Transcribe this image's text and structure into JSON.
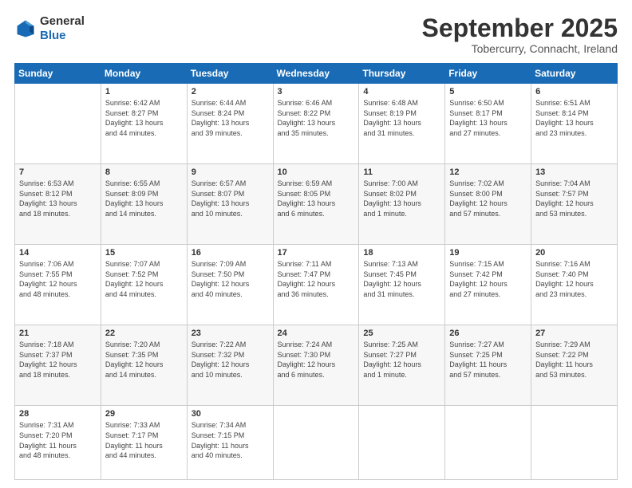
{
  "header": {
    "logo_general": "General",
    "logo_blue": "Blue",
    "month_title": "September 2025",
    "location": "Tobercurry, Connacht, Ireland"
  },
  "days_of_week": [
    "Sunday",
    "Monday",
    "Tuesday",
    "Wednesday",
    "Thursday",
    "Friday",
    "Saturday"
  ],
  "weeks": [
    [
      {
        "day": "",
        "info": ""
      },
      {
        "day": "1",
        "info": "Sunrise: 6:42 AM\nSunset: 8:27 PM\nDaylight: 13 hours\nand 44 minutes."
      },
      {
        "day": "2",
        "info": "Sunrise: 6:44 AM\nSunset: 8:24 PM\nDaylight: 13 hours\nand 39 minutes."
      },
      {
        "day": "3",
        "info": "Sunrise: 6:46 AM\nSunset: 8:22 PM\nDaylight: 13 hours\nand 35 minutes."
      },
      {
        "day": "4",
        "info": "Sunrise: 6:48 AM\nSunset: 8:19 PM\nDaylight: 13 hours\nand 31 minutes."
      },
      {
        "day": "5",
        "info": "Sunrise: 6:50 AM\nSunset: 8:17 PM\nDaylight: 13 hours\nand 27 minutes."
      },
      {
        "day": "6",
        "info": "Sunrise: 6:51 AM\nSunset: 8:14 PM\nDaylight: 13 hours\nand 23 minutes."
      }
    ],
    [
      {
        "day": "7",
        "info": "Sunrise: 6:53 AM\nSunset: 8:12 PM\nDaylight: 13 hours\nand 18 minutes."
      },
      {
        "day": "8",
        "info": "Sunrise: 6:55 AM\nSunset: 8:09 PM\nDaylight: 13 hours\nand 14 minutes."
      },
      {
        "day": "9",
        "info": "Sunrise: 6:57 AM\nSunset: 8:07 PM\nDaylight: 13 hours\nand 10 minutes."
      },
      {
        "day": "10",
        "info": "Sunrise: 6:59 AM\nSunset: 8:05 PM\nDaylight: 13 hours\nand 6 minutes."
      },
      {
        "day": "11",
        "info": "Sunrise: 7:00 AM\nSunset: 8:02 PM\nDaylight: 13 hours\nand 1 minute."
      },
      {
        "day": "12",
        "info": "Sunrise: 7:02 AM\nSunset: 8:00 PM\nDaylight: 12 hours\nand 57 minutes."
      },
      {
        "day": "13",
        "info": "Sunrise: 7:04 AM\nSunset: 7:57 PM\nDaylight: 12 hours\nand 53 minutes."
      }
    ],
    [
      {
        "day": "14",
        "info": "Sunrise: 7:06 AM\nSunset: 7:55 PM\nDaylight: 12 hours\nand 48 minutes."
      },
      {
        "day": "15",
        "info": "Sunrise: 7:07 AM\nSunset: 7:52 PM\nDaylight: 12 hours\nand 44 minutes."
      },
      {
        "day": "16",
        "info": "Sunrise: 7:09 AM\nSunset: 7:50 PM\nDaylight: 12 hours\nand 40 minutes."
      },
      {
        "day": "17",
        "info": "Sunrise: 7:11 AM\nSunset: 7:47 PM\nDaylight: 12 hours\nand 36 minutes."
      },
      {
        "day": "18",
        "info": "Sunrise: 7:13 AM\nSunset: 7:45 PM\nDaylight: 12 hours\nand 31 minutes."
      },
      {
        "day": "19",
        "info": "Sunrise: 7:15 AM\nSunset: 7:42 PM\nDaylight: 12 hours\nand 27 minutes."
      },
      {
        "day": "20",
        "info": "Sunrise: 7:16 AM\nSunset: 7:40 PM\nDaylight: 12 hours\nand 23 minutes."
      }
    ],
    [
      {
        "day": "21",
        "info": "Sunrise: 7:18 AM\nSunset: 7:37 PM\nDaylight: 12 hours\nand 18 minutes."
      },
      {
        "day": "22",
        "info": "Sunrise: 7:20 AM\nSunset: 7:35 PM\nDaylight: 12 hours\nand 14 minutes."
      },
      {
        "day": "23",
        "info": "Sunrise: 7:22 AM\nSunset: 7:32 PM\nDaylight: 12 hours\nand 10 minutes."
      },
      {
        "day": "24",
        "info": "Sunrise: 7:24 AM\nSunset: 7:30 PM\nDaylight: 12 hours\nand 6 minutes."
      },
      {
        "day": "25",
        "info": "Sunrise: 7:25 AM\nSunset: 7:27 PM\nDaylight: 12 hours\nand 1 minute."
      },
      {
        "day": "26",
        "info": "Sunrise: 7:27 AM\nSunset: 7:25 PM\nDaylight: 11 hours\nand 57 minutes."
      },
      {
        "day": "27",
        "info": "Sunrise: 7:29 AM\nSunset: 7:22 PM\nDaylight: 11 hours\nand 53 minutes."
      }
    ],
    [
      {
        "day": "28",
        "info": "Sunrise: 7:31 AM\nSunset: 7:20 PM\nDaylight: 11 hours\nand 48 minutes."
      },
      {
        "day": "29",
        "info": "Sunrise: 7:33 AM\nSunset: 7:17 PM\nDaylight: 11 hours\nand 44 minutes."
      },
      {
        "day": "30",
        "info": "Sunrise: 7:34 AM\nSunset: 7:15 PM\nDaylight: 11 hours\nand 40 minutes."
      },
      {
        "day": "",
        "info": ""
      },
      {
        "day": "",
        "info": ""
      },
      {
        "day": "",
        "info": ""
      },
      {
        "day": "",
        "info": ""
      }
    ]
  ]
}
